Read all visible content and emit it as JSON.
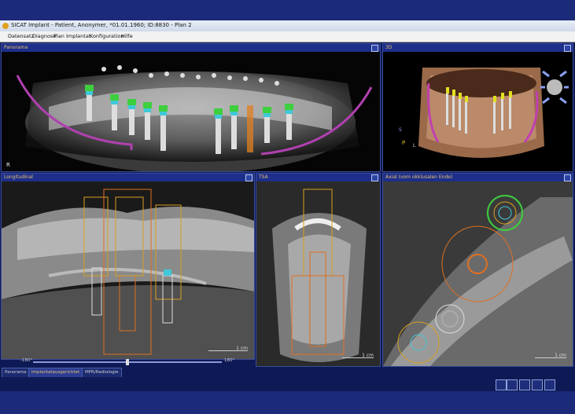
{
  "window": {
    "title": "SICAT Implant - Patient, Anonymer, *01.01.1960; ID:8830 - Plan 2"
  },
  "menu": [
    "Datensatz",
    "Diagnose",
    "Plan",
    "Implantat",
    "Konfiguration",
    "Hilfe"
  ],
  "panels": {
    "panorama": {
      "label": "Panorama",
      "corner": "R"
    },
    "view3d": {
      "label": "3D",
      "orient_s": "S",
      "orient_p": "P",
      "orient_l": "L"
    },
    "longitudinal": {
      "label": "Longitudinal",
      "scale": "1 cm"
    },
    "tsa": {
      "label": "TSA",
      "scale": "1 cm"
    },
    "axial": {
      "label": "Axial (vom okklusalen Ende)",
      "scale": "1 cm"
    }
  },
  "slider": {
    "min_label": "-180°",
    "max_label": "180°"
  },
  "tabs": [
    "Panorama",
    "Implantatausgerichtet",
    "MPR/Radiologie"
  ],
  "active_tab": 1,
  "toolbar_icons": [
    "measure-icon",
    "implant-icon-1",
    "implant-icon-2",
    "implant-icon-3",
    "implant-icon-4"
  ],
  "colors": {
    "accent": "#e8c070",
    "header": "#1d2f8a",
    "implant_green": "#3ecf3e",
    "nerve_purple": "#b040b0",
    "implant_orange": "#e08020"
  }
}
